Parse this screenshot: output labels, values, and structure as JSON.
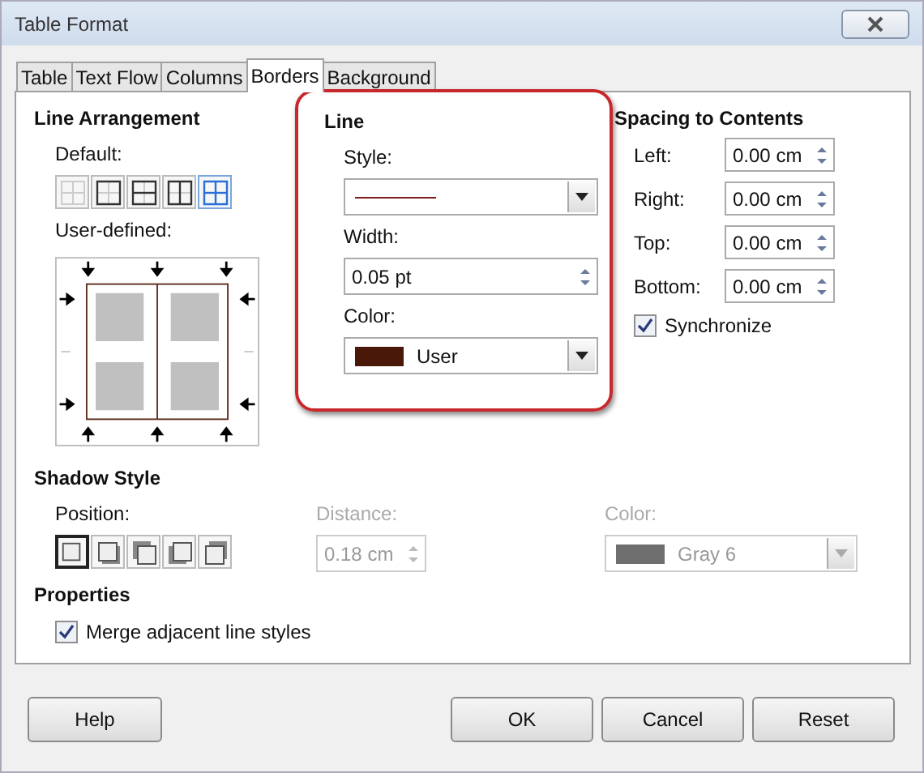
{
  "window": {
    "title": "Table Format"
  },
  "tabs": [
    {
      "label": "Table",
      "selected": false
    },
    {
      "label": "Text Flow",
      "selected": false
    },
    {
      "label": "Columns",
      "selected": false
    },
    {
      "label": "Borders",
      "selected": true
    },
    {
      "label": "Background",
      "selected": false
    }
  ],
  "line_arrangement": {
    "heading": "Line Arrangement",
    "default_label": "Default:",
    "presets": [
      {
        "selected": false
      },
      {
        "selected": false
      },
      {
        "selected": false
      },
      {
        "selected": false
      },
      {
        "selected": true
      }
    ],
    "user_defined_label": "User-defined:"
  },
  "line": {
    "heading": "Line",
    "style_label": "Style:",
    "width_label": "Width:",
    "width_value": "0.05 pt",
    "color_label": "Color:",
    "color_value": "User"
  },
  "spacing": {
    "heading": "Spacing to Contents",
    "fields": [
      {
        "label": "Left:",
        "value": "0.00 cm"
      },
      {
        "label": "Right:",
        "value": "0.00 cm"
      },
      {
        "label": "Top:",
        "value": "0.00 cm"
      },
      {
        "label": "Bottom:",
        "value": "0.00 cm"
      }
    ],
    "synchronize": {
      "label": "Synchronize",
      "checked": true
    }
  },
  "shadow": {
    "heading": "Shadow Style",
    "position_label": "Position:",
    "positions": [
      {
        "selected": true
      },
      {
        "selected": false
      },
      {
        "selected": false
      },
      {
        "selected": false
      },
      {
        "selected": false
      }
    ],
    "distance": {
      "label": "Distance:",
      "value": "0.18 cm",
      "disabled": true
    },
    "color": {
      "label": "Color:",
      "value": "Gray 6",
      "disabled": true
    }
  },
  "properties": {
    "heading": "Properties",
    "merge": {
      "label": "Merge adjacent line styles",
      "checked": true
    }
  },
  "buttons": [
    {
      "label": "Help",
      "kind": "help"
    },
    {
      "label": "OK",
      "kind": "action"
    },
    {
      "label": "Cancel",
      "kind": "action"
    },
    {
      "label": "Reset",
      "kind": "action"
    }
  ]
}
